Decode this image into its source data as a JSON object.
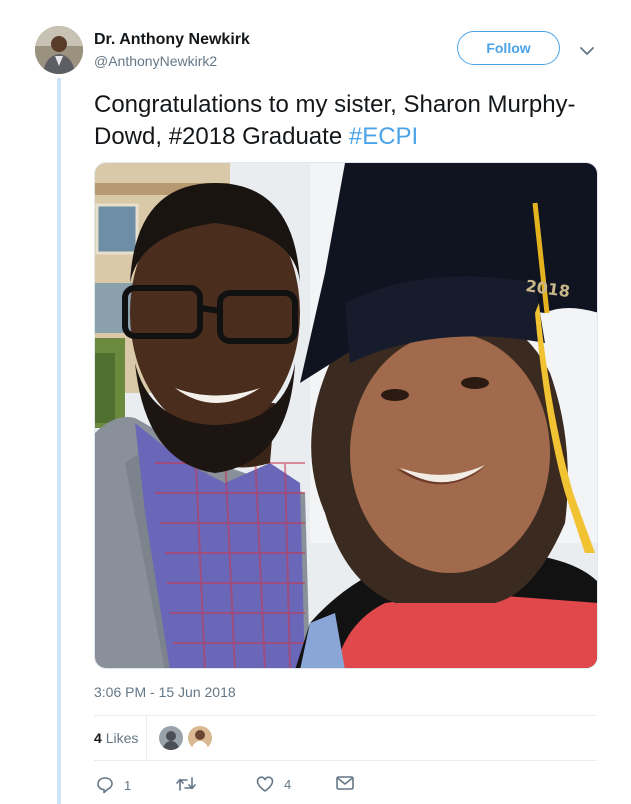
{
  "author": {
    "name": "Dr. Anthony Newkirk",
    "handle": "@AnthonyNewkirk2",
    "avatar_icon": "profile-photo"
  },
  "follow_label": "Follow",
  "tweet": {
    "text": "Congratulations to my sister, Sharon Murphy-Dowd, #2018 Graduate ",
    "hashtag": "#ECPI",
    "timestamp": "3:06 PM - 15 Jun 2018",
    "photo_description_icon": "graduation-selfie-photo",
    "cap_text": "2018"
  },
  "stats": {
    "likes_count": "4",
    "likes_label": "Likes"
  },
  "actions": {
    "reply_count": "1",
    "retweet_count": "",
    "like_count": "4"
  },
  "colors": {
    "accent": "#4ba3e8",
    "thread": "#cfe3f7",
    "muted": "#657786"
  }
}
